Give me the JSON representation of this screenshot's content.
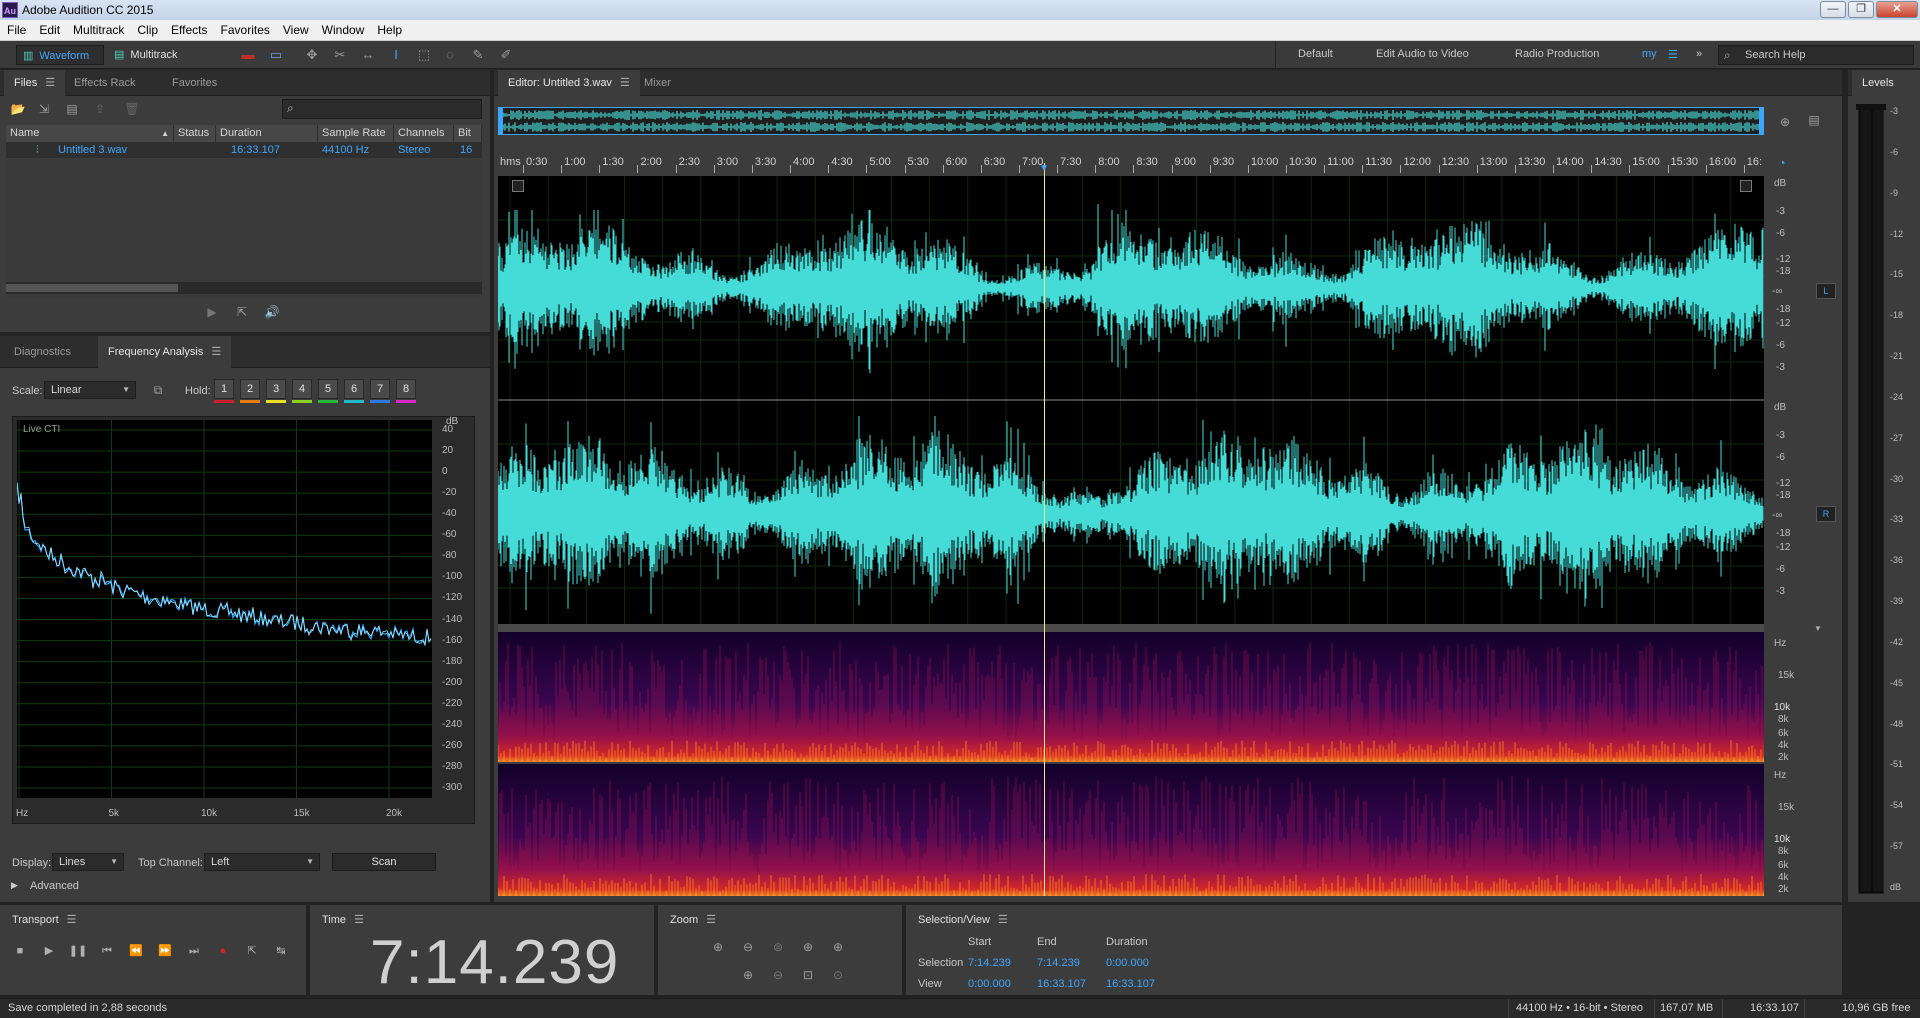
{
  "app": {
    "title": "Adobe Audition CC 2015",
    "logo": "Au",
    "window_controls": [
      "minimize-icon",
      "restore-icon",
      "close-icon"
    ]
  },
  "menu": [
    "File",
    "Edit",
    "Multitrack",
    "Clip",
    "Effects",
    "Favorites",
    "View",
    "Window",
    "Help"
  ],
  "toolbar": {
    "waveform_label": "Waveform",
    "multitrack_label": "Multitrack",
    "workspaces": [
      "Default",
      "Edit Audio to Video",
      "Radio Production",
      "my"
    ],
    "search_placeholder": "Search Help",
    "more_glyph": "»"
  },
  "files_panel": {
    "tabs": [
      "Files",
      "Effects Rack",
      "Favorites"
    ],
    "columns": [
      "Name",
      "Status",
      "Duration",
      "Sample Rate",
      "Channels",
      "Bit D"
    ],
    "rows": [
      {
        "name": "Untitled 3.wav",
        "status": "",
        "duration": "16:33.107",
        "sample_rate": "44100 Hz",
        "channels": "Stereo",
        "bit_depth": "16"
      }
    ]
  },
  "frequency_panel": {
    "tabs": [
      "Diagnostics",
      "Frequency Analysis"
    ],
    "scale_label": "Scale:",
    "scale_value": "Linear",
    "hold_label": "Hold:",
    "hold_buttons": [
      {
        "label": "1",
        "color": "#d0202a"
      },
      {
        "label": "2",
        "color": "#e87b10"
      },
      {
        "label": "3",
        "color": "#e8e020"
      },
      {
        "label": "4",
        "color": "#8bcf1f"
      },
      {
        "label": "5",
        "color": "#25b83c"
      },
      {
        "label": "6",
        "color": "#1fb9c7"
      },
      {
        "label": "7",
        "color": "#2a78e0"
      },
      {
        "label": "8",
        "color": "#d828c8"
      }
    ],
    "live_label": "Live CTI",
    "db_unit": "dB",
    "db_ticks": [
      "40",
      "20",
      "0",
      "-20",
      "-40",
      "-60",
      "-80",
      "-100",
      "-120",
      "-140",
      "-160",
      "-180",
      "-200",
      "-220",
      "-240",
      "-260",
      "-280",
      "-300"
    ],
    "hz_ticks": [
      "Hz",
      "5k",
      "10k",
      "15k",
      "20k"
    ],
    "display_label": "Display:",
    "display_value": "Lines",
    "top_channel_label": "Top Channel:",
    "top_channel_value": "Left",
    "scan_label": "Scan",
    "advanced_label": "Advanced"
  },
  "editor": {
    "tabs": [
      "Editor: Untitled 3.wav",
      "Mixer"
    ],
    "ruler_unit": "hms",
    "ruler_labels": [
      "0:30",
      "1:00",
      "1:30",
      "2:00",
      "2:30",
      "3:00",
      "3:30",
      "4:00",
      "4:30",
      "5:00",
      "5:30",
      "6:00",
      "6:30",
      "7:00",
      "7:30",
      "8:00",
      "8:30",
      "9:00",
      "9:30",
      "10:00",
      "10:30",
      "11:00",
      "11:30",
      "12:00",
      "12:30",
      "13:00",
      "13:30",
      "14:00",
      "14:30",
      "15:00",
      "15:30",
      "16:00",
      "16:"
    ],
    "db_unit": "dB",
    "db_scale_L": [
      "-3",
      "-6",
      "-12",
      "-18",
      "-∞",
      "-18",
      "-12",
      "-6",
      "-3"
    ],
    "db_scale_R": [
      "-3",
      "-6",
      "-12",
      "-18",
      "-∞",
      "-18",
      "-12",
      "-6",
      "-3"
    ],
    "channel_L": "L",
    "channel_R": "R",
    "hz_unit": "Hz",
    "hz_scale": [
      "15k",
      "10k",
      "8k",
      "6k",
      "4k",
      "2k"
    ],
    "waveform_color": "#45dcd8",
    "playhead_position": 0.4314
  },
  "levels": {
    "title": "Levels",
    "ticks": [
      "-3",
      "-6",
      "-9",
      "-12",
      "-15",
      "-18",
      "-21",
      "-24",
      "-27",
      "-30",
      "-33",
      "-36",
      "-39",
      "-42",
      "-45",
      "-48",
      "-51",
      "-54",
      "-57",
      "dB"
    ]
  },
  "transport": {
    "title": "Transport",
    "buttons": [
      "stop-icon",
      "play-icon",
      "pause-icon",
      "go-to-start-icon",
      "rewind-icon",
      "fast-forward-icon",
      "go-to-end-icon",
      "record-icon",
      "play-from-cursor-icon",
      "loop-icon"
    ]
  },
  "time": {
    "title": "Time",
    "value": "7:14.239"
  },
  "zoom": {
    "title": "Zoom"
  },
  "selection_view": {
    "title": "Selection/View",
    "headers": [
      "Start",
      "End",
      "Duration"
    ],
    "selection_label": "Selection",
    "view_label": "View",
    "selection": [
      "7:14.239",
      "7:14.239",
      "0:00.000"
    ],
    "view": [
      "0:00.000",
      "16:33.107",
      "16:33.107"
    ]
  },
  "status": {
    "message": "Save completed in 2,88 seconds",
    "format": "44100 Hz • 16-bit • Stereo",
    "size": "167,07 MB",
    "duration": "16:33.107",
    "free": "10,96 GB free"
  }
}
